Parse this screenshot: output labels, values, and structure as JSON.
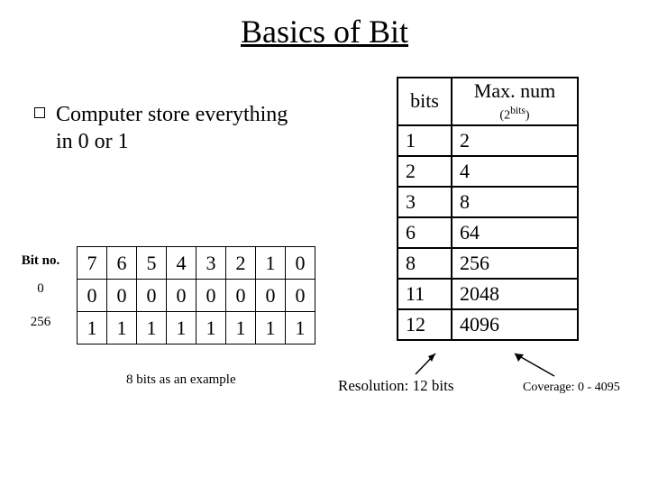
{
  "title": "Basics of Bit",
  "bullet": "Computer store everything in 0 or 1",
  "bits_row_labels": {
    "header": "Bit no.",
    "row0": "0",
    "row256": "256"
  },
  "bits_table": {
    "header": [
      "7",
      "6",
      "5",
      "4",
      "3",
      "2",
      "1",
      "0"
    ],
    "row0": [
      "0",
      "0",
      "0",
      "0",
      "0",
      "0",
      "0",
      "0"
    ],
    "row256": [
      "1",
      "1",
      "1",
      "1",
      "1",
      "1",
      "1",
      "1"
    ]
  },
  "bits_caption": "8 bits as an example",
  "max_table": {
    "col_bits": "bits",
    "col_max": "Max. num",
    "col_max_sub_prefix": "(2",
    "col_max_sub_sup": "bits",
    "col_max_sub_suffix": ")",
    "rows": [
      {
        "bits": "1",
        "max": "2"
      },
      {
        "bits": "2",
        "max": "4"
      },
      {
        "bits": "3",
        "max": "8"
      },
      {
        "bits": "6",
        "max": "64"
      },
      {
        "bits": "8",
        "max": "256"
      },
      {
        "bits": "11",
        "max": "2048"
      },
      {
        "bits": "12",
        "max": "4096"
      }
    ]
  },
  "resolution_label": "Resolution: 12 bits",
  "coverage_label": "Coverage: 0 - 4095"
}
